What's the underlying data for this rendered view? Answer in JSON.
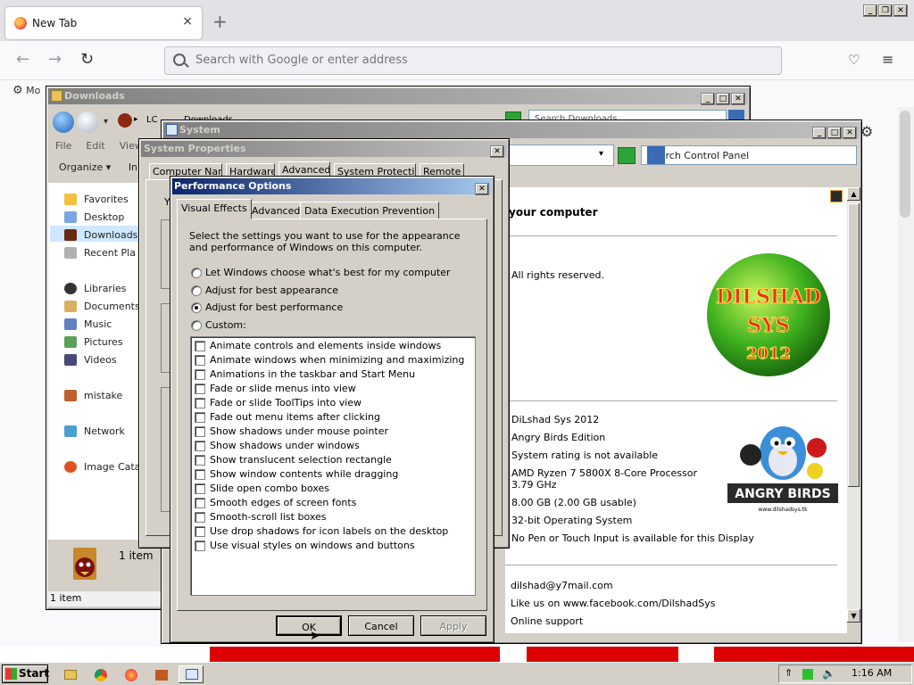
{
  "browser": {
    "tab_title": "New Tab",
    "tab_close": "×",
    "new_tab": "+",
    "url_placeholder": "Search with Google or enter address",
    "bookmark_label": "Mo",
    "window_buttons": [
      "_",
      "❐",
      "✕"
    ]
  },
  "downloads_window": {
    "title": "Downloads",
    "addr_prefix": "LC",
    "addr_path": "Downloads",
    "search_placeholder": "Search Downloads",
    "menu": [
      "File",
      "Edit",
      "View"
    ],
    "organize": "Organize ▾",
    "include": "In",
    "nav": [
      {
        "label": "Favorites",
        "icon": "star-icon"
      },
      {
        "label": "Desktop",
        "icon": "desktop-icon"
      },
      {
        "label": "Downloads",
        "icon": "downloads-icon"
      },
      {
        "label": "Recent Pla",
        "icon": "recent-places-icon"
      },
      {
        "label": "Libraries",
        "icon": "libraries-icon"
      },
      {
        "label": "Documents",
        "icon": "documents-icon"
      },
      {
        "label": "Music",
        "icon": "music-icon"
      },
      {
        "label": "Pictures",
        "icon": "pictures-icon"
      },
      {
        "label": "Videos",
        "icon": "videos-icon"
      },
      {
        "label": "mistake",
        "icon": "homegroup-icon"
      },
      {
        "label": "Network",
        "icon": "network-icon"
      },
      {
        "label": "Image Catalo",
        "icon": "image-catalog-icon"
      }
    ],
    "item_count_label": "1 item",
    "status": "1 item"
  },
  "system_window": {
    "title": "System",
    "search_placeholder": "Search Control Panel",
    "heading": "your computer",
    "copyright": ".  All rights reserved.",
    "logo_text": [
      "DILSHAD",
      "SYS",
      "2012"
    ],
    "angry_birds": "ANGRY BIRDS",
    "angry_birds_url": "www.dilshadsys.tk",
    "info": [
      "DiLshad Sys 2012",
      "Angry Birds Edition",
      "System rating is not available",
      "AMD Ryzen 7 5800X 8-Core Processor",
      "3.79 GHz",
      "8.00 GB (2.00 GB usable)",
      "32-bit Operating System",
      "No Pen or Touch Input is available for this Display"
    ],
    "contact": [
      "dilshad@y7mail.com",
      "Like us on www.facebook.com/DilshadSys",
      "Online support"
    ]
  },
  "system_properties": {
    "title": "System Properties",
    "tabs": [
      "Computer Name",
      "Hardware",
      "Advanced",
      "System Protection",
      "Remote"
    ],
    "panel_letter": "Y"
  },
  "performance_options": {
    "title": "Performance Options",
    "tabs": [
      "Visual Effects",
      "Advanced",
      "Data Execution Prevention"
    ],
    "description": "Select the settings you want to use for the appearance and performance of Windows on this computer.",
    "radios": [
      {
        "label": "Let Windows choose what's best for my computer",
        "checked": false
      },
      {
        "label": "Adjust for best appearance",
        "checked": false
      },
      {
        "label": "Adjust for best performance",
        "checked": true
      },
      {
        "label": "Custom:",
        "checked": false
      }
    ],
    "effects": [
      "Animate controls and elements inside windows",
      "Animate windows when minimizing and maximizing",
      "Animations in the taskbar and Start Menu",
      "Fade or slide menus into view",
      "Fade or slide ToolTips into view",
      "Fade out menu items after clicking",
      "Show shadows under mouse pointer",
      "Show shadows under windows",
      "Show translucent selection rectangle",
      "Show window contents while dragging",
      "Slide open combo boxes",
      "Smooth edges of screen fonts",
      "Smooth-scroll list boxes",
      "Use drop shadows for icon labels on the desktop",
      "Use visual styles on windows and buttons"
    ],
    "buttons": {
      "ok": "OK",
      "cancel": "Cancel",
      "apply": "Apply"
    }
  },
  "taskbar": {
    "start": "Start",
    "clock": "1:16 AM"
  },
  "colors": {
    "classic_face": "#d4d0c8",
    "active_title": "#0a246a",
    "inactive_title": "#808080",
    "firefox_tabstrip": "#e1e1e6"
  }
}
